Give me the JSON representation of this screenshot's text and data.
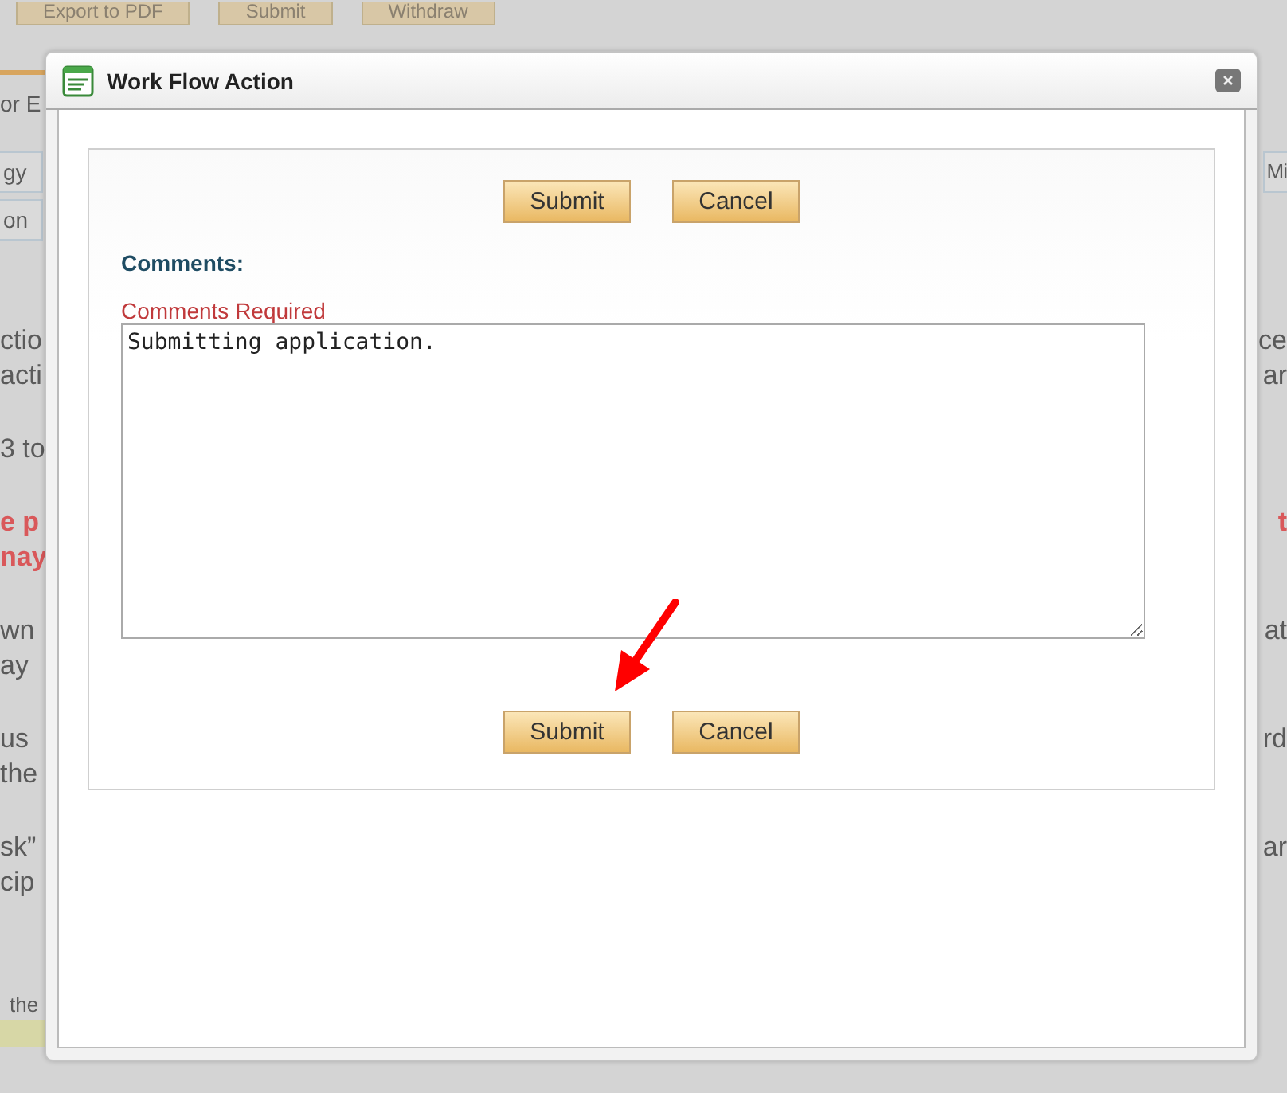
{
  "page": {
    "top_buttons": [
      "Export to PDF",
      "Submit",
      "Withdraw"
    ],
    "heading": {
      "left": "or E"
    },
    "tabs": [
      {
        "left": "gy",
        "right": "Mi"
      },
      {
        "left": "on"
      }
    ],
    "paragraphs": [
      {
        "kind": "text",
        "lines": [
          {
            "left": "ctio",
            "right": "ce"
          },
          {
            "left": "acti",
            "right": "ar"
          }
        ]
      },
      {
        "kind": "text",
        "lines": [
          {
            "left": "3 to"
          }
        ]
      },
      {
        "kind": "warning",
        "lines": [
          {
            "left": "e p",
            "right": "t"
          },
          {
            "left": "nay"
          }
        ]
      },
      {
        "kind": "text",
        "lines": [
          {
            "left": "wn",
            "right": "at"
          },
          {
            "left": "ay"
          }
        ]
      },
      {
        "kind": "text",
        "lines": [
          {
            "left": "us",
            "right": "rd"
          },
          {
            "left": "the"
          }
        ]
      },
      {
        "kind": "text",
        "lines": [
          {
            "left": "sk”",
            "right": "ar"
          },
          {
            "left": "cip"
          }
        ]
      }
    ],
    "footer": {
      "left": "the"
    }
  },
  "dialog": {
    "title": "Work Flow Action",
    "top_buttons": [
      "Submit",
      "Cancel"
    ],
    "comments_label": "Comments:",
    "required_note": "Comments Required",
    "comment_value": "Submitting application.",
    "bottom_buttons": [
      "Submit",
      "Cancel"
    ]
  },
  "annotation": {
    "kind": "arrow"
  }
}
